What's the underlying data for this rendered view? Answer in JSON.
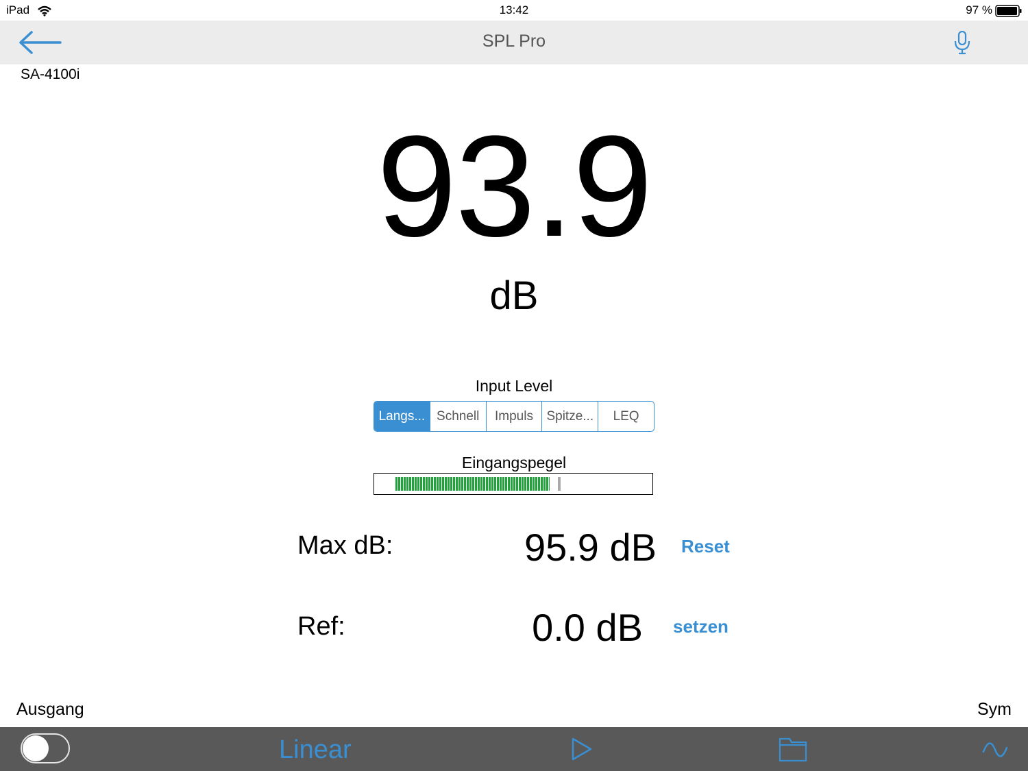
{
  "status_bar": {
    "device": "iPad",
    "time": "13:42",
    "battery": "97 %"
  },
  "nav": {
    "title": "SPL Pro",
    "back_icon": "arrow-left-icon",
    "mic_icon": "microphone-icon"
  },
  "device_name": "SA-4100i",
  "reading": {
    "value": "93.9",
    "unit": "dB"
  },
  "input_level": {
    "label": "Input Level",
    "options": [
      "Langs...",
      "Schnell",
      "Impuls",
      "Spitze...",
      "LEQ"
    ],
    "selected": "Langs..."
  },
  "meter": {
    "label": "Eingangspegel",
    "level_fraction": 0.555,
    "peak_fraction": 0.66,
    "fill_color": "#1fa33a"
  },
  "max": {
    "label": "Max dB:",
    "value": "95.9 dB",
    "action": "Reset"
  },
  "ref": {
    "label": "Ref:",
    "value": "0.0 dB",
    "action": "setzen"
  },
  "bottom": {
    "output_label": "Ausgang",
    "sym_label": "Sym",
    "output_toggle_on": false,
    "weighting": "Linear"
  },
  "colors": {
    "accent": "#3a8fd2",
    "toolbar": "#595959",
    "nav": "#ececec"
  }
}
